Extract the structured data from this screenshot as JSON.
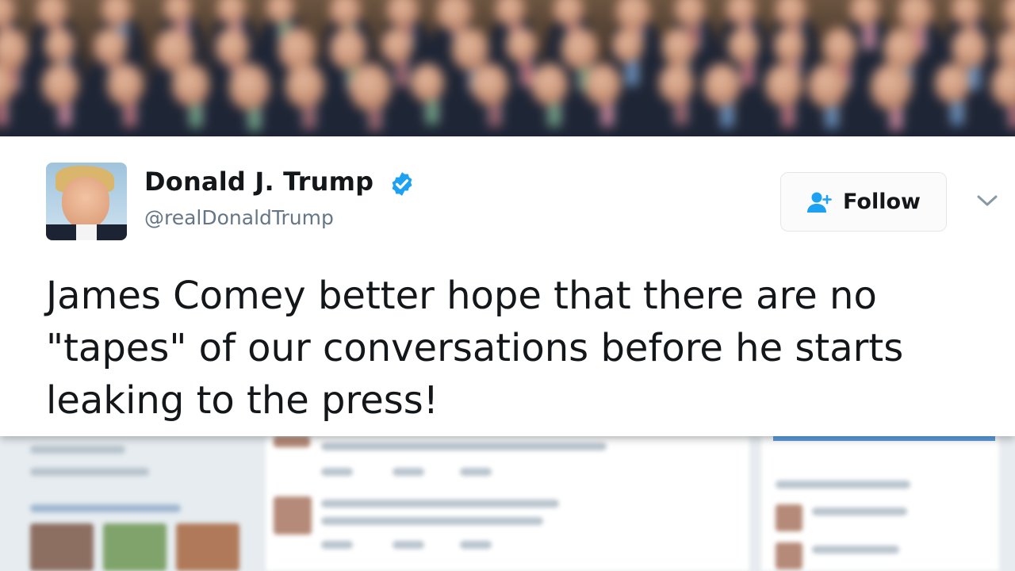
{
  "profile": {
    "display_name": "Donald J. Trump",
    "handle": "@realDonaldTrump",
    "verified": true,
    "avatar_icon": "profile-avatar"
  },
  "actions": {
    "follow_label": "Follow",
    "follow_icon": "add-person-icon",
    "more_icon": "chevron-down-icon"
  },
  "tweet": {
    "text": "James Comey better hope that there are no \"tapes\" of our conversations before he starts leaking to the press!"
  },
  "colors": {
    "verified_blue": "#1da1f2",
    "follow_icon_blue": "#1da1f2",
    "text_primary": "#14171a",
    "text_secondary": "#657786"
  }
}
